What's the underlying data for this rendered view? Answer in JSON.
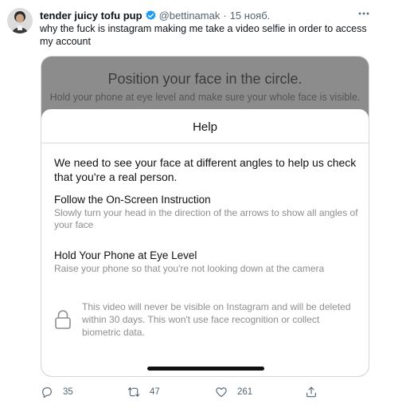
{
  "tweet": {
    "display_name": "tender juicy tofu pup",
    "handle": "@bettinamak",
    "separator": "·",
    "date": "15 нояб.",
    "text": "why the fuck is instagram making me take a video selfie in order to access my account",
    "more_icon": "ellipsis-icon",
    "verified_color": "#1d9bf0"
  },
  "screenshot": {
    "backdrop_title": "Position your face in the circle.",
    "backdrop_subtitle": "Hold your phone at eye level and make sure your whole face is visible.",
    "sheet_title": "Help",
    "intro": "We need to see your face at different angles to help us check that you're a real person.",
    "sections": [
      {
        "heading": "Follow the On-Screen Instruction",
        "body": "Slowly turn your head in the direction of the arrows to show all angles of your face"
      },
      {
        "heading": "Hold Your Phone at Eye Level",
        "body": "Raise your phone so that you're not looking down at the camera"
      }
    ],
    "privacy_note": "This video will never be visible on Instagram and will be deleted within 30 days. This won't use face recognition or collect biometric data.",
    "lock_icon": "lock-icon"
  },
  "actions": {
    "reply_count": "35",
    "retweet_count": "47",
    "like_count": "261",
    "icons": [
      "reply-icon",
      "retweet-icon",
      "like-icon",
      "share-icon"
    ],
    "color": "#536471"
  }
}
